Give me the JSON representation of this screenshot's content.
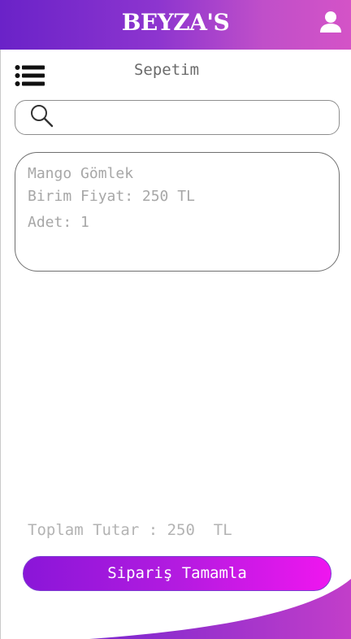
{
  "app": {
    "brand": "BEYZA'S"
  },
  "header": {
    "title": "Sepetim"
  },
  "icons": {
    "user": "user-icon",
    "menu": "list-menu-icon",
    "search": "search-icon"
  },
  "search": {
    "value": "",
    "placeholder": ""
  },
  "cart": {
    "items": [
      {
        "name": "Mango Gömlek",
        "unit_price": "Birim Fiyat: 250 TL",
        "quantity": "Adet: 1"
      }
    ]
  },
  "summary": {
    "total": "Toplam Tutar : 250  TL"
  },
  "actions": {
    "complete_order": "Sipariş Tamamla"
  },
  "colors": {
    "header_start": "#6a22c8",
    "header_end": "#d453c7",
    "button_start": "#8a16d8",
    "button_end": "#ef16ef"
  }
}
